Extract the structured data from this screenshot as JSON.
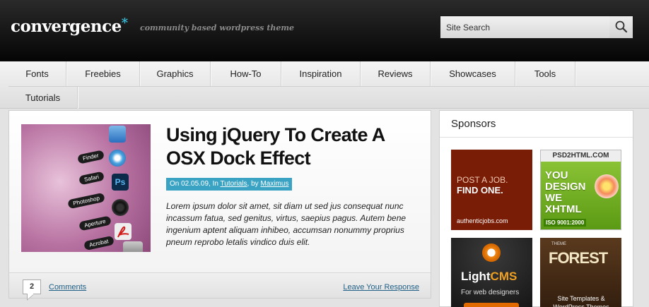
{
  "header": {
    "logo_text": "convergence",
    "logo_star": "*",
    "tagline": "community based wordpress theme",
    "search_placeholder": "Site Search",
    "search_icon": "search-icon"
  },
  "nav": {
    "items": [
      {
        "label": "Fonts"
      },
      {
        "label": "Freebies"
      },
      {
        "label": "Graphics"
      },
      {
        "label": "How-To"
      },
      {
        "label": "Inspiration"
      },
      {
        "label": "Reviews"
      },
      {
        "label": "Showcases"
      },
      {
        "label": "Tools"
      },
      {
        "label": "Tutorials"
      }
    ]
  },
  "post": {
    "title": "Using jQuery To Create A OSX Dock Effect",
    "meta": {
      "prefix": "On 02.05.09, In ",
      "category": "Tutorials",
      "by": ", by ",
      "author": "Maximus"
    },
    "excerpt": "Lorem ipsum dolor sit amet, sit diam ut sed jus consequat nunc incassum fatua, sed genitus, virtus, saepius pagus. Autem bene ingenium aptent aliquam inhibeo, accumsan nonummy proprius pneum reprobo letalis vindico duis elit.",
    "thumbnail_labels": [
      "Finder",
      "Safari",
      "Photoshop",
      "Aperture",
      "Acrobat"
    ],
    "thumbnail_icon_text": "Ps",
    "comment_count": "2",
    "comments_label": "Comments",
    "leave_response_label": "Leave Your Response"
  },
  "sponsors": {
    "title": "Sponsors",
    "ads": [
      {
        "line1": "POST A JOB.",
        "line2": "FIND ONE.",
        "footer": "authenticjobs.com"
      },
      {
        "top": "PSD2HTML.COM",
        "big": "YOU DESIGN WE XHTML",
        "badge": "ISO 9001:2000"
      },
      {
        "name": "Light",
        "name_accent": "CMS",
        "sub": "For web designers"
      },
      {
        "small": "THEME",
        "name": "FOREST",
        "sub": "Site Templates & WordPress Themes"
      }
    ]
  },
  "colors": {
    "accent": "#3aa3c4",
    "link": "#1f5f86",
    "header_bg": "#050505"
  }
}
